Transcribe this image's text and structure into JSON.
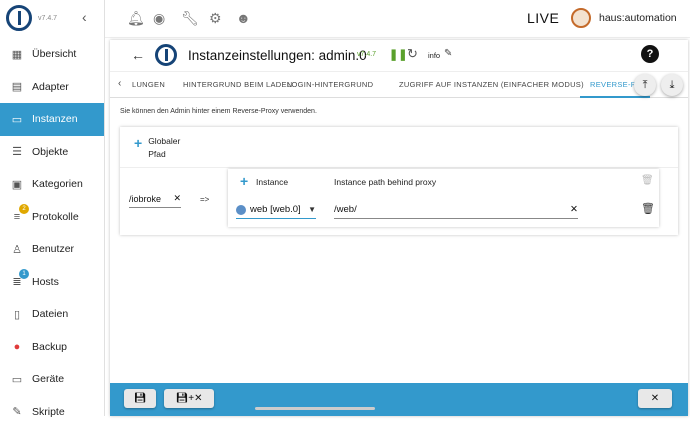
{
  "app": {
    "version": "v7.4.7"
  },
  "sidebar": {
    "items": [
      {
        "label": "Übersicht",
        "icon": "apps-icon"
      },
      {
        "label": "Adapter",
        "icon": "store-icon"
      },
      {
        "label": "Instanzen",
        "icon": "instances-icon",
        "active": true
      },
      {
        "label": "Objekte",
        "icon": "list-icon"
      },
      {
        "label": "Kategorien",
        "icon": "categories-icon"
      },
      {
        "label": "Protokolle",
        "icon": "log-icon",
        "badge": "2"
      },
      {
        "label": "Benutzer",
        "icon": "user-icon"
      },
      {
        "label": "Hosts",
        "icon": "hosts-icon",
        "badge": "1"
      },
      {
        "label": "Dateien",
        "icon": "files-icon"
      },
      {
        "label": "Backup",
        "icon": "backup-icon"
      },
      {
        "label": "Geräte",
        "icon": "devices-icon"
      },
      {
        "label": "Skripte",
        "icon": "scripts-icon"
      }
    ]
  },
  "topbar": {
    "live": "LIVE",
    "host": "haus:automation"
  },
  "panel": {
    "title": "Instanzeinstellungen: admin.0",
    "version": "v7.4.7",
    "info": "info",
    "tabs": [
      "LUNGEN",
      "HINTERGRUND BEIM LADEN",
      "LOGIN-HINTERGRUND",
      "ZUGRIFF AUF INSTANZEN (EINFACHER MODUS)",
      "REVERSE-P"
    ],
    "active_tab": "REVERSE-P",
    "description": "Sie können den Admin hinter einem Reverse-Proxy verwenden.",
    "global_label_1": "Globaler",
    "global_label_2": "Pfad",
    "path_value": "/iobroke",
    "arrow": "=>",
    "instance_header": "Instance",
    "proxy_header": "Instance path behind proxy",
    "instance_value": "web [web.0]",
    "proxy_value": "/web/"
  },
  "colors": {
    "accent": "#3399cc",
    "brand": "#164477",
    "running": "#5aa02c"
  }
}
